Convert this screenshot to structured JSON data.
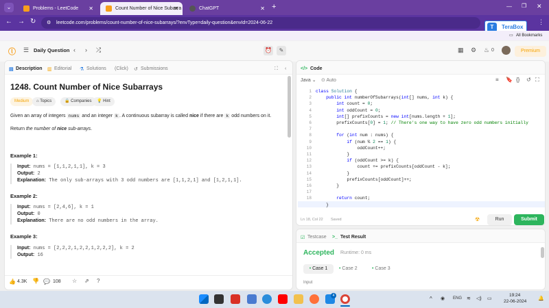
{
  "browser": {
    "tabs": [
      {
        "label": "Problems - LeetCode",
        "color": "#f89f1b"
      },
      {
        "label": "Count Number of Nice Subarra",
        "color": "#f89f1b"
      },
      {
        "label": "ChatGPT",
        "color": "#555555"
      }
    ],
    "url": "leetcode.com/problems/count-number-of-nice-subarrays/?envType=daily-question&envId=2024-06-22",
    "terabox": "TeraBox",
    "bookmarks": "All Bookmarks"
  },
  "lc": {
    "daily": "Daily Question",
    "streak": "0",
    "premium": "Premium"
  },
  "left": {
    "tabs": [
      "Description",
      "Editorial",
      "Solutions",
      "(Click)",
      "Submissions"
    ],
    "title": "1248. Count Number of Nice Subarrays",
    "chips": [
      "Medium",
      "Topics",
      "Companies",
      "Hint"
    ],
    "desc_a": "Given an array of integers",
    "desc_nums": "nums",
    "desc_b": "and an integer",
    "desc_k": "k",
    "desc_c": ". A continuous subarray is called",
    "desc_nice": "nice",
    "desc_d": "if there are",
    "desc_e": "odd numbers on it.",
    "ret_a": "Return",
    "ret_b": "the number of",
    "ret_c": "nice",
    "ret_d": "sub-arrays",
    "examples": [
      {
        "head": "Example 1:",
        "input": "nums = [1,1,2,1,1], k = 3",
        "output": "2",
        "expl": "The only sub-arrays with 3 odd numbers are [1,1,2,1] and [1,2,1,1]."
      },
      {
        "head": "Example 2:",
        "input": "nums = [2,4,6], k = 1",
        "output": "0",
        "expl": "There are no odd numbers in the array."
      },
      {
        "head": "Example 3:",
        "input": "nums = [2,2,2,1,2,2,1,2,2,2], k = 2",
        "output": "16"
      }
    ],
    "labels": {
      "input": "Input:",
      "output": "Output:",
      "expl": "Explanation:"
    },
    "likes": "4.3K",
    "comments": "108"
  },
  "code": {
    "tab": "Code",
    "lang": "Java",
    "auto": "Auto",
    "status": "Ln 18, Col 22",
    "saved": "Saved",
    "run": "Run",
    "submit": "Submit"
  },
  "test": {
    "tab1": "Testcase",
    "tab2": "Test Result",
    "accepted": "Accepted",
    "runtime": "Runtime: 0 ms",
    "cases": [
      "Case 1",
      "Case 2",
      "Case 3"
    ],
    "input_label": "Input"
  },
  "taskbar": {
    "lang": "ENG",
    "time": "19:24",
    "date": "22-06-2024",
    "badge": "4"
  }
}
